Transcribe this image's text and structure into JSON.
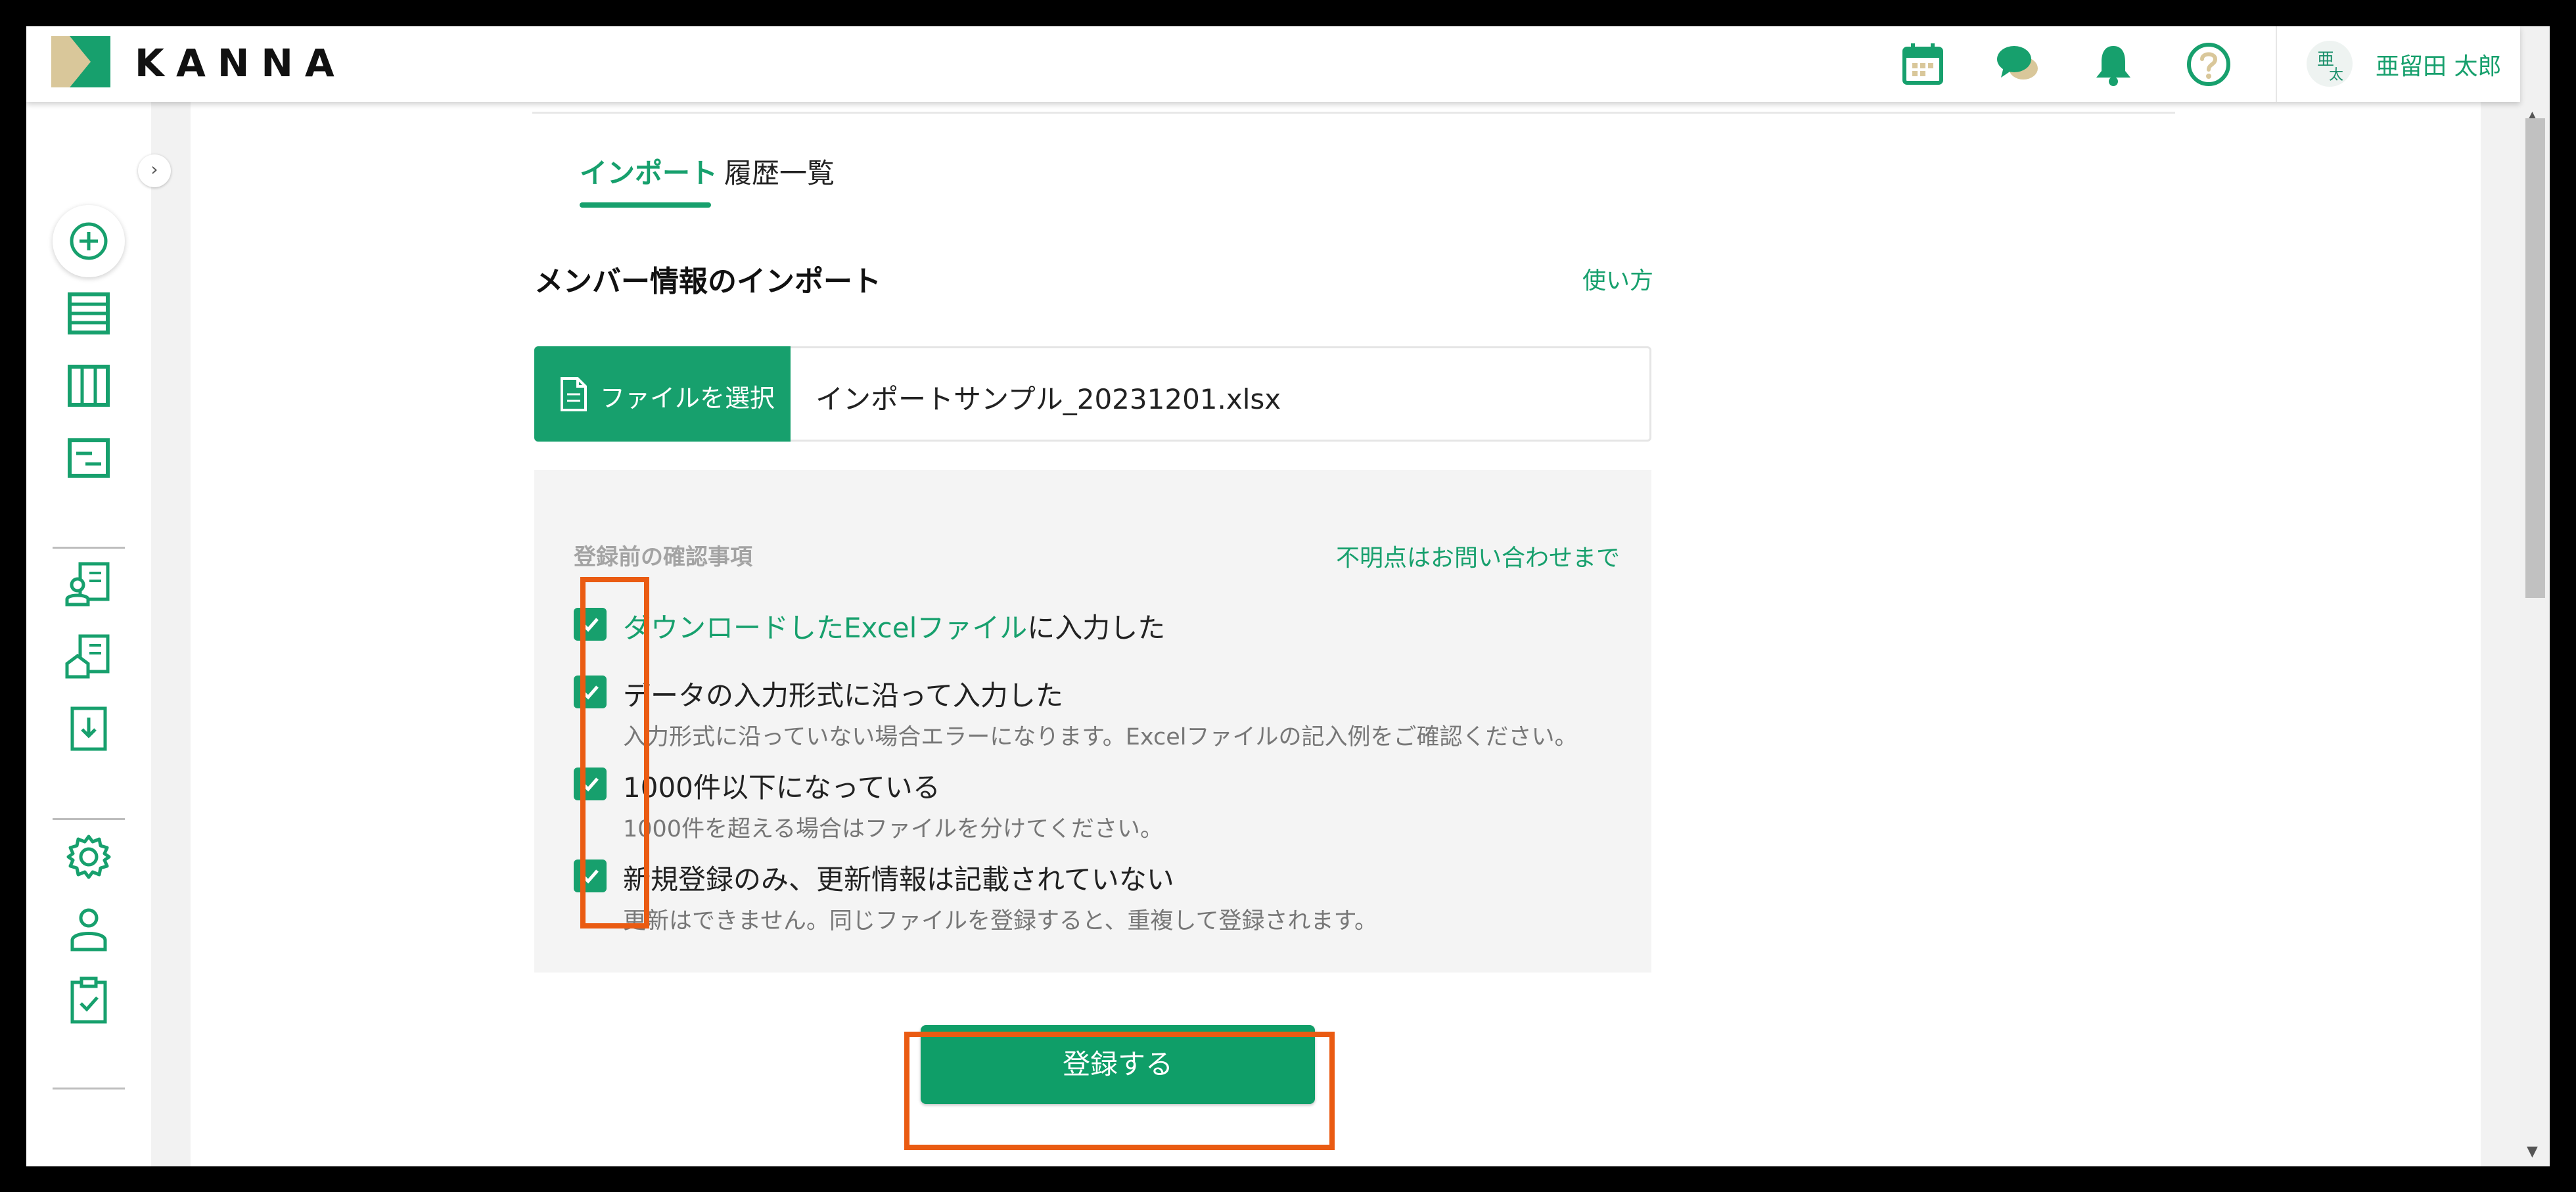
{
  "brand": {
    "name": "KANNA",
    "accent": "#17a06d",
    "highlight": "#ea5b12"
  },
  "header": {
    "icons": [
      "calendar-icon",
      "chat-icon",
      "bell-icon",
      "help-icon"
    ],
    "user": {
      "avatar_top": "亜",
      "avatar_bottom": "太",
      "name": "亜留田 太郎"
    }
  },
  "sidebar": {
    "collapse_glyph": "›",
    "icons": [
      "list-icon",
      "columns-icon",
      "report-icon",
      "member-card-icon",
      "company-card-icon",
      "import-icon",
      "settings-icon",
      "user-icon",
      "clipboard-check-icon"
    ]
  },
  "tabs": [
    {
      "label": "インポート",
      "active": true
    },
    {
      "label": "履歴一覧",
      "active": false
    }
  ],
  "import": {
    "title": "メンバー情報のインポート",
    "usage_link": "使い方",
    "file_button": "ファイルを選択",
    "file_name": "インポートサンプル_20231201.xlsx"
  },
  "confirm": {
    "title": "登録前の確認事項",
    "contact_link": "不明点はお問い合わせまで",
    "items": [
      {
        "link": "ダウンロードしたExcelファイル",
        "text": "に入力した",
        "sub": "",
        "checked": true
      },
      {
        "link": "",
        "text": "データの入力形式に沿って入力した",
        "sub": "入力形式に沿っていない場合エラーになります。Excelファイルの記入例をご確認ください。",
        "checked": true
      },
      {
        "link": "",
        "text": "1000件以下になっている",
        "sub": "1000件を超える場合はファイルを分けてください。",
        "checked": true
      },
      {
        "link": "",
        "text": "新規登録のみ、更新情報は記載されていない",
        "sub": "更新はできません。同じファイルを登録すると、重複して登録されます。",
        "checked": true
      }
    ]
  },
  "register_button": "登録する"
}
